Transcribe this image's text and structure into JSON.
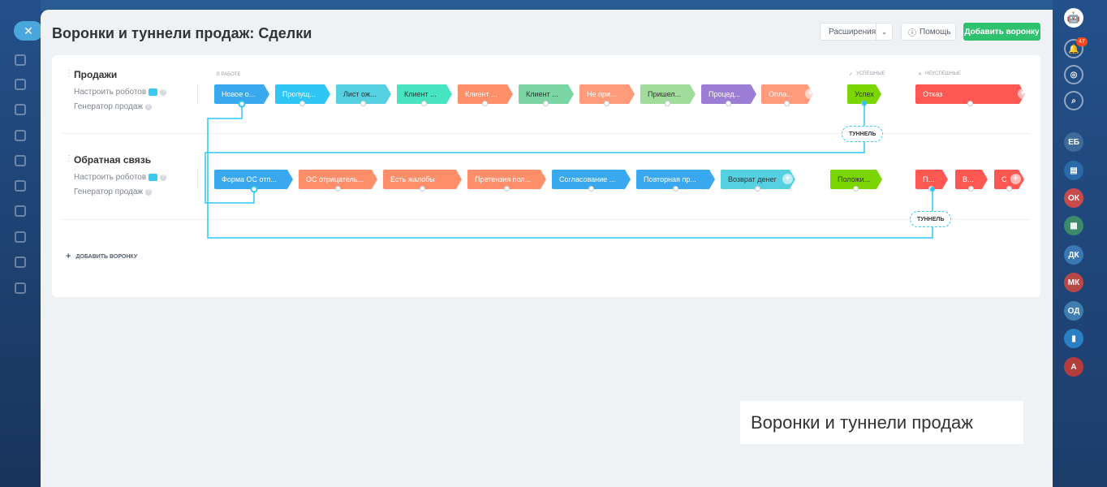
{
  "header": {
    "title": "Воронки и туннели продаж: Сделки",
    "extensions_label": "Расширения",
    "help_label": "Помощь",
    "add_funnel_label": "Добавить воронку"
  },
  "sections": {
    "in_work": "В РАБОТЕ",
    "success": "УСПЕШНЫЕ",
    "fail": "НЕУСПЕШНЫЕ"
  },
  "funnels": [
    {
      "name": "Продажи",
      "robots_link": "Настроить роботов",
      "generator_link": "Генератор продаж",
      "stages": [
        {
          "label": "Новое о...",
          "color": "#39a8ef"
        },
        {
          "label": "Пропущ...",
          "color": "#2fc6f6"
        },
        {
          "label": "Лист ож...",
          "color": "#55d0e0"
        },
        {
          "label": "Клиент ...",
          "color": "#47e4c2"
        },
        {
          "label": "Клиент ...",
          "color": "#ff8f6b"
        },
        {
          "label": "Клиент ...",
          "color": "#7bd4a3"
        },
        {
          "label": "Не при...",
          "color": "#ff9a7a"
        },
        {
          "label": "Пришел...",
          "color": "#a1dc9c"
        },
        {
          "label": "Процед...",
          "color": "#9b7dd4"
        },
        {
          "label": "Опла...",
          "color": "#ff9a7a"
        }
      ],
      "success": {
        "label": "Успех",
        "color": "#7bd500"
      },
      "fail": [
        {
          "label": "Отказ",
          "color": "#ff5752"
        }
      ],
      "tunnel_label": "ТУННЕЛЬ"
    },
    {
      "name": "Обратная связь",
      "robots_link": "Настроить роботов",
      "generator_link": "Генератор продаж",
      "stages": [
        {
          "label": "Форма ОС отп...",
          "color": "#39a8ef"
        },
        {
          "label": "ОС отрицатель...",
          "color": "#ff8f6b"
        },
        {
          "label": "Есть жалобы",
          "color": "#ff8f6b"
        },
        {
          "label": "Претензия пол...",
          "color": "#ff8f6b"
        },
        {
          "label": "Согласование ...",
          "color": "#39a8ef"
        },
        {
          "label": "Повторная пр...",
          "color": "#39a8ef"
        },
        {
          "label": "Возврат денег",
          "color": "#55d0e0"
        }
      ],
      "success": {
        "label": "Положи...",
        "color": "#7bd500"
      },
      "fail": [
        {
          "label": "П...",
          "color": "#ff5752"
        },
        {
          "label": "В...",
          "color": "#ff5752"
        },
        {
          "label": "С",
          "color": "#ff5752"
        }
      ],
      "tunnel_label": "ТУННЕЛЬ"
    }
  ],
  "add_funnel_link": "ДОБАВИТЬ ВОРОНКУ",
  "caption": "Воронки и туннели продаж",
  "right_bar": {
    "notifications_count": "47",
    "avatars": [
      {
        "label": "ЕБ",
        "color": "#3e6b9a"
      },
      {
        "label": "ОК",
        "color": "#c84a4a"
      },
      {
        "label": "ДК",
        "color": "#3a78b4"
      },
      {
        "label": "МК",
        "color": "#b84848"
      },
      {
        "label": "ОД",
        "color": "#3f7db0"
      },
      {
        "label": "А",
        "color": "#b43c3c"
      }
    ]
  }
}
